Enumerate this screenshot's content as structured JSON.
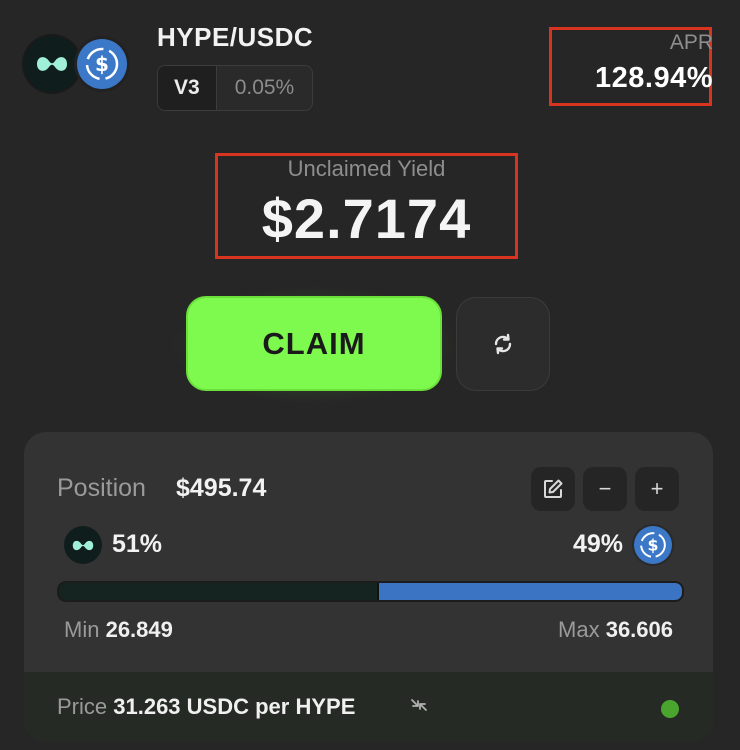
{
  "pair": {
    "name": "HYPE/USDC",
    "version": "V3",
    "fee": "0.05%",
    "token0_icon": "hype-token-icon",
    "token1_icon": "usdc-token-icon"
  },
  "apr": {
    "label": "APR",
    "value": "128.94%"
  },
  "yield": {
    "label": "Unclaimed Yield",
    "value": "$2.7174"
  },
  "actions": {
    "claim_label": "CLAIM",
    "refresh_icon": "refresh-icon"
  },
  "position": {
    "label": "Position",
    "value": "$495.74",
    "token0_share": "51%",
    "token1_share": "49%",
    "token0_fraction": 0.51,
    "min_label": "Min",
    "min_value": "26.849",
    "max_label": "Max",
    "max_value": "36.606",
    "edit_icon": "edit-icon",
    "remove_symbol": "−",
    "add_symbol": "+"
  },
  "price": {
    "label": "Price",
    "value": "31.263",
    "unit": "USDC per HYPE",
    "status": "in-range"
  },
  "colors": {
    "accent": "#7ef94d",
    "highlight_border": "#d9341f",
    "token1_blue": "#3b78c8",
    "status_green": "#4aa52e"
  }
}
